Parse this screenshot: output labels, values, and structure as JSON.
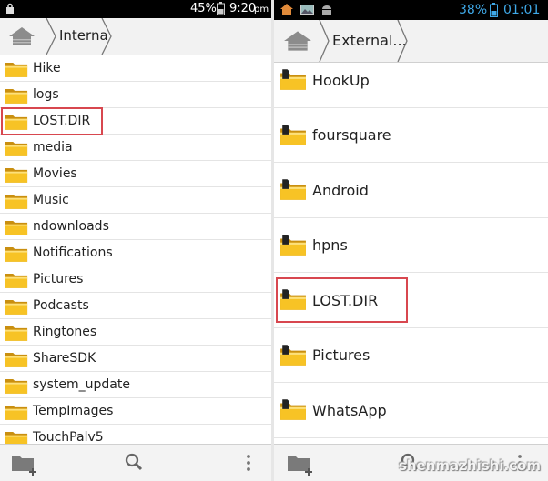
{
  "left": {
    "status": {
      "battery": "45%",
      "time": "9:20",
      "ampm": "pm"
    },
    "breadcrumb": {
      "path": "Interna"
    },
    "folders": [
      {
        "label": "Hike"
      },
      {
        "label": "logs"
      },
      {
        "label": "LOST.DIR",
        "highlighted": true
      },
      {
        "label": "media"
      },
      {
        "label": "Movies"
      },
      {
        "label": "Music"
      },
      {
        "label": "ndownloads"
      },
      {
        "label": "Notifications"
      },
      {
        "label": "Pictures"
      },
      {
        "label": "Podcasts"
      },
      {
        "label": "Ringtones"
      },
      {
        "label": "ShareSDK"
      },
      {
        "label": "system_update"
      },
      {
        "label": "TempImages"
      },
      {
        "label": "TouchPalv5"
      }
    ],
    "toolbar": [
      "new-folder-icon",
      "search-icon",
      "overflow-menu-icon"
    ]
  },
  "right": {
    "status": {
      "battery": "38%",
      "time": "01:01"
    },
    "breadcrumb": {
      "path": "External..."
    },
    "folders": [
      {
        "label": "HookUp"
      },
      {
        "label": "foursquare"
      },
      {
        "label": "Android"
      },
      {
        "label": "hpns"
      },
      {
        "label": "LOST.DIR",
        "highlighted": true
      },
      {
        "label": "Pictures"
      },
      {
        "label": "WhatsApp"
      }
    ],
    "toolbar": [
      "new-folder-icon",
      "search-icon",
      "overflow-menu-icon"
    ]
  },
  "watermark": "shenmazhishi.com",
  "colors": {
    "folder": "#f7c325",
    "highlight": "#d8474f",
    "statusbar": "#000000",
    "battery_text_right": "#3fa9e8"
  }
}
